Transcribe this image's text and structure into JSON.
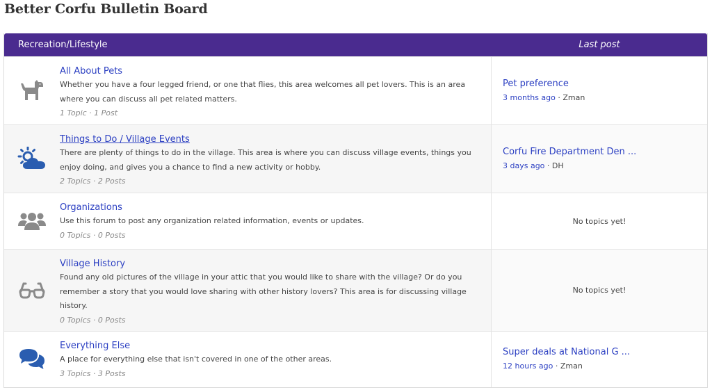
{
  "page": {
    "title": "Better Corfu Bulletin Board"
  },
  "board": {
    "category": "Recreation/Lifestyle",
    "last_post_header": "Last post"
  },
  "colors": {
    "header_bg": "#4a2b8f",
    "link": "#2b3fc2",
    "icon_gray": "#8a8a8a",
    "icon_blue": "#2a5db0"
  },
  "forums": [
    {
      "title": "All About Pets",
      "icon": "dog-icon",
      "description": "Whether you have a four legged friend, or one that flies, this area welcomes all pet lovers. This is an area where you can discuss all pet related matters.",
      "stats": "1 Topic · 1 Post",
      "last_post": {
        "title": "Pet preference",
        "ago": "3 months ago",
        "sep": " · ",
        "author": "Zman"
      }
    },
    {
      "title": "Things to Do / Village Events",
      "icon": "sun-cloud-icon",
      "description": "There are plenty of things to do in the village. This area is where you can discuss village events, things you enjoy doing, and gives you a chance to find a new activity or hobby.",
      "stats": "2 Topics · 2 Posts",
      "last_post": {
        "title": "Corfu Fire Department Den ...",
        "ago": "3 days ago",
        "sep": " · ",
        "author": "DH"
      }
    },
    {
      "title": "Organizations",
      "icon": "users-icon",
      "description": "Use this forum to post any organization related information, events or updates.",
      "stats": "0 Topics · 0 Posts",
      "last_post": {
        "empty": "No topics yet!"
      }
    },
    {
      "title": "Village History",
      "icon": "glasses-icon",
      "description": "Found any old pictures of the village in your attic that you would like to share with the village? Or do you remember a story that you would love sharing with other history lovers? This area is for discussing village history.",
      "stats": "0 Topics · 0 Posts",
      "last_post": {
        "empty": "No topics yet!"
      }
    },
    {
      "title": "Everything Else",
      "icon": "chat-bubbles-icon",
      "description": "A place for everything else that isn't covered in one of the other areas.",
      "stats": "3 Topics · 3 Posts",
      "last_post": {
        "title": "Super deals at National G ...",
        "ago": "12 hours ago",
        "sep": " · ",
        "author": "Zman"
      }
    }
  ]
}
